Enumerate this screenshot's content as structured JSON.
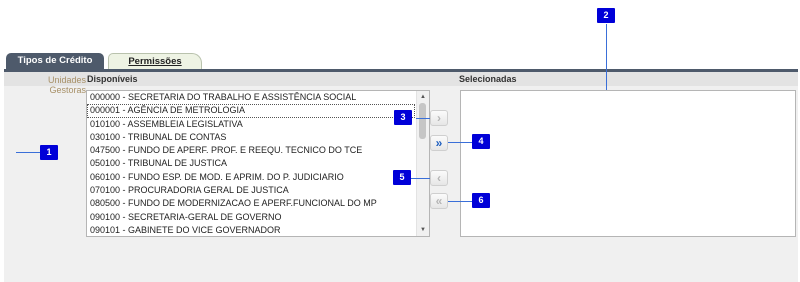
{
  "tabs": [
    {
      "label": "Tipos de Crédito"
    },
    {
      "label": "Permissões"
    }
  ],
  "labels": {
    "unidades_gestoras": "Unidades Gestoras",
    "disponiveis": "Disponíveis",
    "selecionadas": "Selecionadas"
  },
  "available_list": [
    "000000 - SECRETARIA DO TRABALHO E ASSISTÊNCIA SOCIAL",
    "000001 - AGÊNCIA DE METROLOGIA",
    "010100 - ASSEMBLEIA LEGISLATIVA",
    "030100 - TRIBUNAL DE CONTAS",
    "047500 - FUNDO DE APERF. PROF. E REEQU. TECNICO DO TCE",
    "050100 - TRIBUNAL DE JUSTICA",
    "060100 - FUNDO ESP. DE MOD. E APRIM. DO P. JUDICIARIO",
    "070100 - PROCURADORIA GERAL DE JUSTICA",
    "080500 - FUNDO DE MODERNIZACAO E APERF.FUNCIONAL DO MP",
    "090100 - SECRETARIA-GERAL DE GOVERNO",
    "090101 - GABINETE DO VICE GOVERNADOR"
  ],
  "buttons": {
    "move_selected": "›",
    "move_all": "»",
    "remove_selected": "‹",
    "remove_all": "«"
  },
  "markers": [
    "1",
    "2",
    "3",
    "4",
    "5",
    "6"
  ],
  "icons": {
    "scroll_up": "scroll-up-arrow-icon",
    "scroll_down": "scroll-down-arrow-icon"
  },
  "colors": {
    "tab_dark": "#4e5a6b",
    "tab_active_bg": "#eef3e4",
    "marker_bg": "#0000d8",
    "active_arrow": "#1f5fbf",
    "label_accent": "#a79067"
  }
}
